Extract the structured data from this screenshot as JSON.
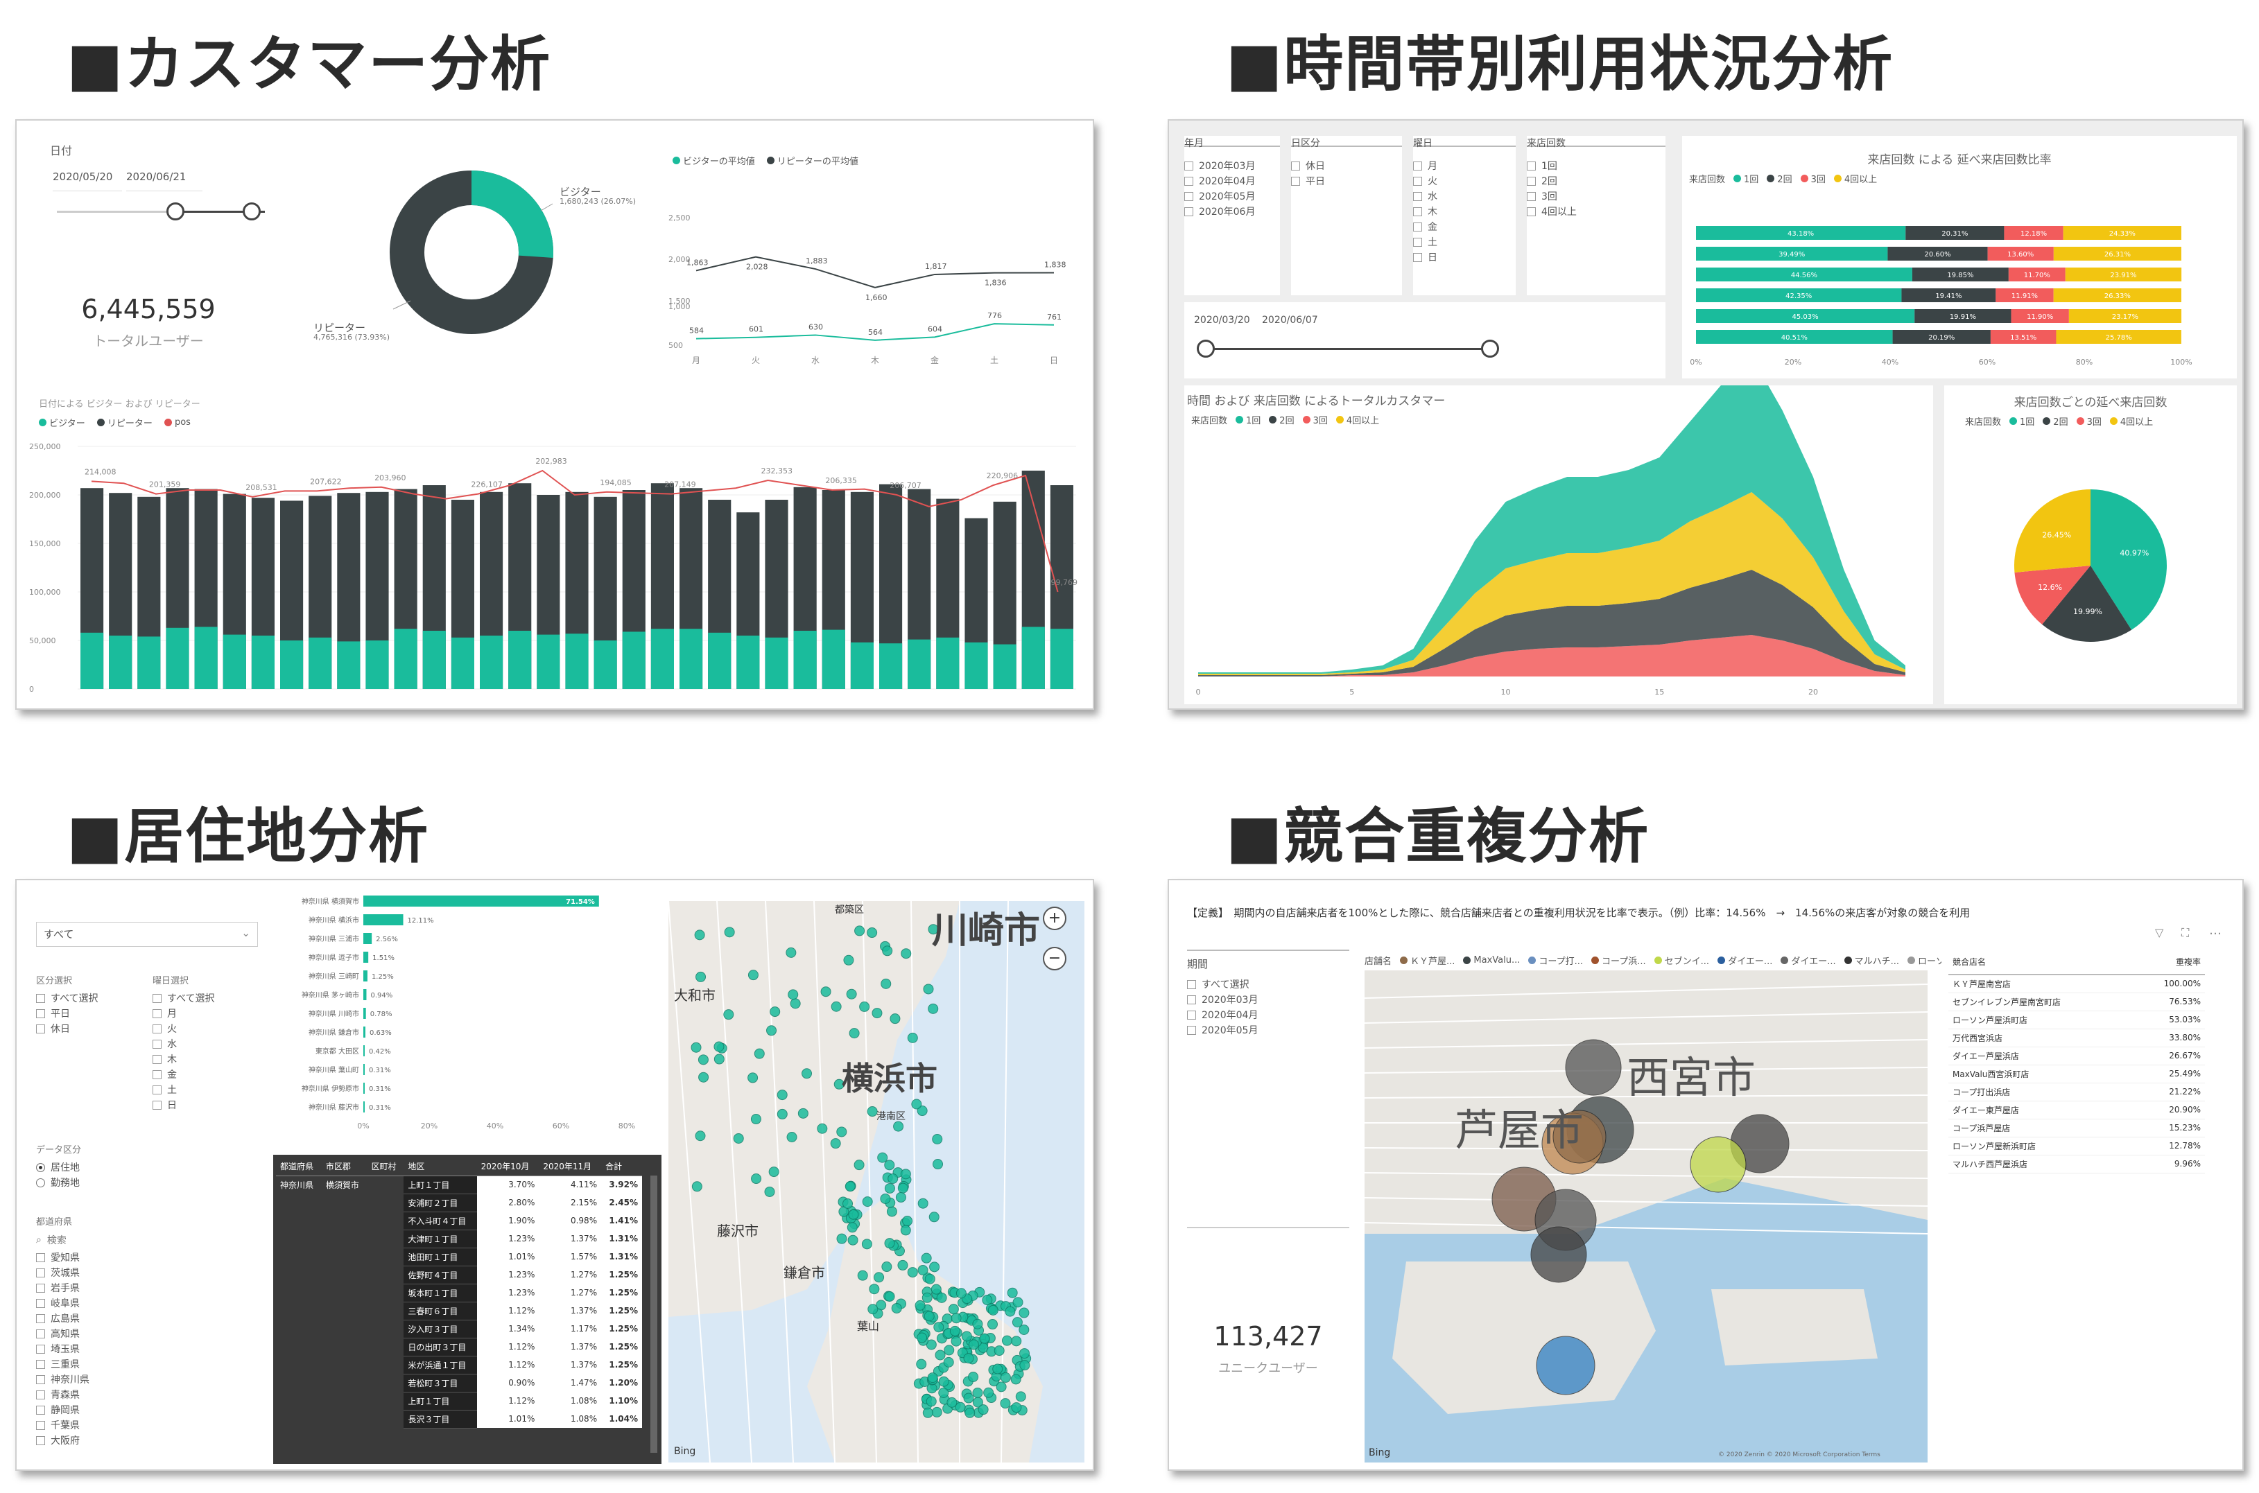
{
  "sections": {
    "customer": {
      "title": "■カスタマー分析"
    },
    "time": {
      "title": "■時間帯別利用状況分析"
    },
    "residence": {
      "title": "■居住地分析"
    },
    "competitor": {
      "title": "■競合重複分析"
    }
  },
  "customer": {
    "date_label": "日付",
    "date_from": "2020/05/20",
    "date_to": "2020/06/21",
    "kpi_value": "6,445,559",
    "kpi_label": "トータルユーザー",
    "donut": {
      "visitor_label": "ビジター",
      "visitor_value": "1,680,243 (26.07%)",
      "repeater_label": "リピーター",
      "repeater_value": "4,765,316 (73.93%)",
      "visitor_pct": 26.07,
      "colors": {
        "visitor": "#1abc9c",
        "repeater": "#3b4446"
      }
    },
    "avg_chart": {
      "legend_visitor": "ビジターの平均値",
      "legend_repeater": "リピーターの平均値",
      "days": [
        "月",
        "火",
        "水",
        "木",
        "金",
        "土",
        "日"
      ],
      "repeater": [
        1863,
        2028,
        1883,
        1660,
        1817,
        1836,
        1838
      ],
      "visitor": [
        584,
        601,
        630,
        564,
        604,
        776,
        761
      ],
      "repeater_labels": [
        "1,863",
        "2,028",
        "1,883",
        "1,660",
        "1,817",
        "1,836",
        "1,838"
      ],
      "visitor_labels": [
        "584",
        "601",
        "630",
        "564",
        "604",
        "776",
        "761"
      ],
      "upper_ticks": [
        "2,500",
        "2,000",
        "1,500"
      ],
      "lower_ticks": [
        "1,000",
        "500"
      ]
    },
    "bar_chart": {
      "title": "日付による ビジター および リピーター",
      "legend": [
        "ビジター",
        "リピーター",
        "pos"
      ],
      "y_ticks": [
        "250,000",
        "200,000",
        "150,000",
        "100,000",
        "50,000",
        "0"
      ],
      "totals": [
        207000,
        202000,
        198000,
        207000,
        206000,
        201000,
        197000,
        194000,
        199000,
        202000,
        203000,
        206000,
        210000,
        195000,
        203000,
        212000,
        200000,
        203000,
        198000,
        205000,
        212000,
        207000,
        195000,
        182000,
        195000,
        208000,
        205000,
        203000,
        211000,
        206000,
        196000,
        176000,
        193000,
        225000,
        210000
      ],
      "visitors": [
        58000,
        55000,
        54000,
        63000,
        64000,
        56000,
        55000,
        50000,
        53000,
        49000,
        50000,
        62000,
        60000,
        53000,
        55000,
        60000,
        56000,
        57000,
        50000,
        59000,
        62000,
        62000,
        58000,
        55000,
        53000,
        60000,
        61000,
        48000,
        47000,
        51000,
        53000,
        48000,
        46000,
        64000,
        62000
      ],
      "line": [
        214000,
        212000,
        201000,
        205000,
        205000,
        198000,
        204000,
        204000,
        207000,
        208000,
        201000,
        196000,
        201000,
        210000,
        225000,
        200000,
        203000,
        202000,
        201000,
        204000,
        207000,
        215000,
        210000,
        205000,
        206000,
        200000,
        188000,
        195000,
        210000,
        220000,
        100000
      ],
      "line_labels": [
        "214,008",
        "201,359",
        "208,531",
        "207,622",
        "203,960",
        "226,107",
        "202,983",
        "194,085",
        "207,149",
        "232,353",
        "206,335",
        "206,707",
        "220,906",
        "99,769"
      ],
      "max": 250000
    }
  },
  "time": {
    "slicers": {
      "month": {
        "title": "年月",
        "items": [
          "2020年03月",
          "2020年04月",
          "2020年05月",
          "2020年06月"
        ]
      },
      "daytype": {
        "title": "日区分",
        "items": [
          "休日",
          "平日"
        ]
      },
      "weekday": {
        "title": "曜日",
        "items": [
          "月",
          "火",
          "水",
          "木",
          "金",
          "土",
          "日"
        ]
      },
      "visits": {
        "title": "来店回数",
        "items": [
          "1回",
          "2回",
          "3回",
          "4回以上"
        ]
      }
    },
    "date_from": "2020/03/20",
    "date_to": "2020/06/07",
    "stacked": {
      "title": "来店回数 による 延べ来店回数比率",
      "legend_title": "来店回数",
      "legend": [
        "1回",
        "2回",
        "3回",
        "4回以上"
      ],
      "rows": [
        [
          43.18,
          20.31,
          12.18,
          24.33
        ],
        [
          39.49,
          20.6,
          13.6,
          26.31
        ],
        [
          44.56,
          19.85,
          11.7,
          23.91
        ],
        [
          42.35,
          19.41,
          11.91,
          26.33
        ],
        [
          45.03,
          19.91,
          11.9,
          23.17
        ],
        [
          40.51,
          20.19,
          13.51,
          25.78
        ]
      ],
      "labels": [
        [
          "43.18%",
          "20.31%",
          "12.18%",
          "24.33%"
        ],
        [
          "39.49%",
          "20.60%",
          "13.60%",
          "26.31%"
        ],
        [
          "44.56%",
          "19.85%",
          "11.70%",
          "23.91%"
        ],
        [
          "42.35%",
          "19.41%",
          "11.91%",
          "26.33%"
        ],
        [
          "45.03%",
          "19.91%",
          "11.90%",
          "23.17%"
        ],
        [
          "40.51%",
          "20.19%",
          "13.51%",
          "25.78%"
        ]
      ],
      "x_ticks": [
        "0%",
        "20%",
        "40%",
        "60%",
        "80%",
        "100%"
      ]
    },
    "area": {
      "title": "時間 および 来店回数 によるトータルカスタマー",
      "legend_title": "来店回数",
      "legend": [
        "1回",
        "2回",
        "3回",
        "4回以上"
      ],
      "x_ticks": [
        "0",
        "5",
        "10",
        "15",
        "20"
      ],
      "hours": [
        0,
        1,
        2,
        3,
        4,
        5,
        6,
        7,
        8,
        9,
        10,
        11,
        12,
        13,
        14,
        15,
        16,
        17,
        18,
        19,
        20,
        21,
        22,
        23
      ],
      "one": [
        1,
        1,
        1,
        1,
        1,
        2,
        3,
        8,
        22,
        38,
        48,
        52,
        55,
        55,
        56,
        60,
        72,
        88,
        98,
        78,
        58,
        30,
        10,
        3
      ],
      "two": [
        1,
        1,
        1,
        1,
        1,
        1,
        2,
        4,
        12,
        20,
        26,
        28,
        30,
        30,
        31,
        33,
        38,
        42,
        47,
        40,
        30,
        16,
        5,
        2
      ],
      "three": [
        0,
        0,
        0,
        0,
        0,
        1,
        1,
        3,
        8,
        14,
        18,
        20,
        21,
        21,
        22,
        23,
        26,
        28,
        30,
        26,
        20,
        11,
        4,
        1
      ],
      "four": [
        1,
        1,
        1,
        1,
        1,
        1,
        2,
        5,
        16,
        26,
        34,
        36,
        38,
        38,
        40,
        42,
        48,
        52,
        56,
        48,
        36,
        20,
        7,
        2
      ]
    },
    "pie": {
      "title": "来店回数ごとの延べ来店回数",
      "legend_title": "来店回数",
      "legend": [
        "1回",
        "2回",
        "3回",
        "4回以上"
      ],
      "values": [
        40.97,
        19.99,
        12.6,
        26.45
      ],
      "labels": [
        "40.97%",
        "19.99%",
        "12.6%",
        "26.45%"
      ]
    },
    "colors": [
      "#1abc9c",
      "#3b4446",
      "#f25c5c",
      "#f2c511"
    ]
  },
  "residence": {
    "top_select_value": "すべて",
    "area_title": "区分選択",
    "area_items": [
      "すべて選択",
      "平日",
      "休日"
    ],
    "day_title": "曜日選択",
    "day_items": [
      "すべて選択",
      "月",
      "火",
      "水",
      "木",
      "金",
      "土",
      "日"
    ],
    "type_title": "データ区分",
    "type_items": [
      "居住地",
      "勤務地"
    ],
    "pref_title": "都道府県",
    "search_placeholder": "検索",
    "prefs": [
      "愛知県",
      "茨城県",
      "岩手県",
      "岐阜県",
      "広島県",
      "高知県",
      "埼玉県",
      "三重県",
      "神奈川県",
      "青森県",
      "静岡県",
      "千葉県",
      "大阪府"
    ],
    "bars": [
      {
        "label": "神奈川県 横須賀市",
        "value": 71.54,
        "text": "71.54%"
      },
      {
        "label": "神奈川県 横浜市",
        "value": 12.11,
        "text": "12.11%"
      },
      {
        "label": "神奈川県 三浦市",
        "value": 2.56,
        "text": "2.56%"
      },
      {
        "label": "神奈川県 逗子市",
        "value": 1.51,
        "text": "1.51%"
      },
      {
        "label": "神奈川県 三崎町",
        "value": 1.25,
        "text": "1.25%"
      },
      {
        "label": "神奈川県 茅ヶ崎市",
        "value": 0.94,
        "text": "0.94%"
      },
      {
        "label": "神奈川県 川崎市",
        "value": 0.78,
        "text": "0.78%"
      },
      {
        "label": "神奈川県 鎌倉市",
        "value": 0.63,
        "text": "0.63%"
      },
      {
        "label": "東京都 大田区",
        "value": 0.42,
        "text": "0.42%"
      },
      {
        "label": "神奈川県 葉山町",
        "value": 0.31,
        "text": "0.31%"
      },
      {
        "label": "神奈川県 伊勢原市",
        "value": 0.31,
        "text": "0.31%"
      },
      {
        "label": "神奈川県 藤沢市",
        "value": 0.31,
        "text": "0.31%"
      }
    ],
    "bar_ticks": [
      "0%",
      "20%",
      "40%",
      "60%",
      "80%"
    ],
    "table": {
      "headers": [
        "都道府県",
        "市区郡",
        "区町村",
        "地区",
        "2020年10月",
        "2020年11月",
        "合計"
      ],
      "pref": "神奈川県",
      "city": "横須賀市",
      "rows": [
        [
          "上町１丁目",
          "3.70%",
          "4.11%",
          "3.92%"
        ],
        [
          "安浦町２丁目",
          "2.80%",
          "2.15%",
          "2.45%"
        ],
        [
          "不入斗町４丁目",
          "1.90%",
          "0.98%",
          "1.41%"
        ],
        [
          "大津町１丁目",
          "1.23%",
          "1.37%",
          "1.31%"
        ],
        [
          "池田町１丁目",
          "1.01%",
          "1.57%",
          "1.31%"
        ],
        [
          "佐野町４丁目",
          "1.23%",
          "1.27%",
          "1.25%"
        ],
        [
          "坂本町１丁目",
          "1.23%",
          "1.27%",
          "1.25%"
        ],
        [
          "三春町６丁目",
          "1.12%",
          "1.37%",
          "1.25%"
        ],
        [
          "汐入町３丁目",
          "1.34%",
          "1.17%",
          "1.25%"
        ],
        [
          "日の出町３丁目",
          "1.12%",
          "1.37%",
          "1.25%"
        ],
        [
          "米が浜通１丁目",
          "1.12%",
          "1.37%",
          "1.25%"
        ],
        [
          "若松町３丁目",
          "0.90%",
          "1.47%",
          "1.20%"
        ],
        [
          "上町１丁目",
          "1.12%",
          "1.08%",
          "1.10%"
        ],
        [
          "長沢３丁目",
          "1.01%",
          "1.08%",
          "1.04%"
        ]
      ]
    },
    "map_labels": {
      "kawasaki": "川崎市",
      "yokohama": "横浜市",
      "yamato": "大和市",
      "fujisawa": "藤沢市",
      "kamakura": "鎌倉市",
      "hayama": "葉山",
      "toshima": "都築区",
      "minami": "港南区",
      "bing": "Bing"
    }
  },
  "competitor": {
    "definition": "【定義】　期間内の自店舗来店者を100%とした際に、競合店舗来店者との重複利用状況を比率で表示。（例）比率：14.56%　→　14.56%の来店客が対象の競合を利用",
    "period_title": "期間",
    "period_items": [
      "すべて選択",
      "2020年03月",
      "2020年04月",
      "2020年05月"
    ],
    "kpi_value": "113,427",
    "kpi_label": "ユニークユーザー",
    "map_legend": [
      "店舗名",
      "ＫＹ芦屋...",
      "MaxValu...",
      "コープ打...",
      "コープ浜...",
      "セブンイ...",
      "ダイエー...",
      "ダイエー...",
      "マルハチ...",
      "ローソン..."
    ],
    "map_labels": {
      "nishinomiya": "西宮市",
      "ashiya": "芦屋市",
      "bing": "Bing",
      "copyright": "© 2020 Zenrin  © 2020 Microsoft Corporation  Terms"
    },
    "table": {
      "headers": [
        "競合店名",
        "重複率"
      ],
      "rows": [
        [
          "ＫＹ芦屋南宮店",
          "100.00%"
        ],
        [
          "セブンイレブン芦屋南宮町店",
          "76.53%"
        ],
        [
          "ローソン芦屋浜町店",
          "53.03%"
        ],
        [
          "万代西宮浜店",
          "33.80%"
        ],
        [
          "ダイエー芦屋浜店",
          "26.67%"
        ],
        [
          "MaxValu西宮浜町店",
          "25.49%"
        ],
        [
          "コープ打出浜店",
          "21.22%"
        ],
        [
          "ダイエー東芦屋店",
          "20.90%"
        ],
        [
          "コープ浜芦屋店",
          "15.23%"
        ],
        [
          "ローソン芦屋新浜町店",
          "12.78%"
        ],
        [
          "マルハチ西芦屋浜店",
          "9.96%"
        ]
      ]
    }
  }
}
